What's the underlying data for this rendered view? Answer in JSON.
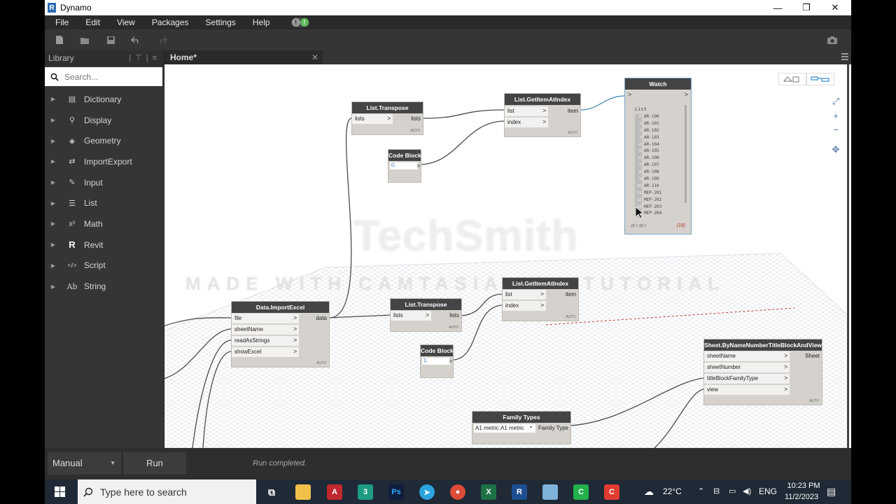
{
  "window": {
    "title": "Dynamo",
    "minimize": "—",
    "maximize": "❐",
    "close": "✕"
  },
  "menu": {
    "items": [
      "File",
      "Edit",
      "View",
      "Packages",
      "Settings",
      "Help"
    ],
    "notify_left": "!",
    "notify_right": "!"
  },
  "library": {
    "title": "Library",
    "search_placeholder": "Search...",
    "items": [
      {
        "label": "Dictionary",
        "icon": "dictionary-icon"
      },
      {
        "label": "Display",
        "icon": "display-icon"
      },
      {
        "label": "Geometry",
        "icon": "geometry-icon"
      },
      {
        "label": "ImportExport",
        "icon": "import-export-icon"
      },
      {
        "label": "Input",
        "icon": "input-icon"
      },
      {
        "label": "List",
        "icon": "list-icon"
      },
      {
        "label": "Math",
        "icon": "math-icon"
      },
      {
        "label": "Revit",
        "icon": "revit-icon"
      },
      {
        "label": "Script",
        "icon": "script-icon"
      },
      {
        "label": "String",
        "icon": "string-icon"
      }
    ],
    "icon_glyphs": [
      "▤",
      "⚲",
      "◈",
      "⇄",
      "✎",
      "☰",
      "x²",
      "R",
      "</>",
      "Ab"
    ]
  },
  "tab": {
    "label": "Home*",
    "close": "✕"
  },
  "nodes": {
    "transpose1": {
      "title": "List.Transpose",
      "in": "lists",
      "out": "lists",
      "auto": "AUTO"
    },
    "code1": {
      "title": "Code Block",
      "code": "0;"
    },
    "getitem1": {
      "title": "List.GetItemAtIndex",
      "in1": "list",
      "in2": "index",
      "out": "item",
      "auto": "AUTO"
    },
    "watch": {
      "title": "Watch",
      "list_label": "List",
      "rows": [
        {
          "i": "0",
          "v": "AR-100"
        },
        {
          "i": "1",
          "v": "AR-101"
        },
        {
          "i": "2",
          "v": "AR-102"
        },
        {
          "i": "3",
          "v": "AR-103"
        },
        {
          "i": "4",
          "v": "AR-104"
        },
        {
          "i": "5",
          "v": "AR-105"
        },
        {
          "i": "6",
          "v": "AR-106"
        },
        {
          "i": "7",
          "v": "AR-107"
        },
        {
          "i": "8",
          "v": "AR-108"
        },
        {
          "i": "9",
          "v": "AR-109"
        },
        {
          "i": "10",
          "v": "AR-110"
        },
        {
          "i": "11",
          "v": "MEP-201"
        },
        {
          "i": "12",
          "v": "MEP-202"
        },
        {
          "i": "13",
          "v": "MEP-203"
        },
        {
          "i": "14",
          "v": "MEP-204"
        }
      ],
      "footer_left": "@L2 @L1",
      "footer_right": "{18}"
    },
    "importexcel": {
      "title": "Data.ImportExcel",
      "in1": "file",
      "in2": "sheetName",
      "in3": "readAsStrings",
      "in4": "showExcel",
      "out": "data",
      "auto": "AUTO"
    },
    "transpose2": {
      "title": "List.Transpose",
      "in": "lists",
      "out": "lists",
      "auto": "AUTO"
    },
    "getitem2": {
      "title": "List.GetItemAtIndex",
      "in1": "list",
      "in2": "index",
      "out": "item",
      "auto": "AUTO"
    },
    "code2": {
      "title": "Code Block",
      "code": "1;"
    },
    "sheet": {
      "title": "Sheet.ByNameNumberTitleBlockAndView",
      "in1": "sheetName",
      "in2": "sheetNumber",
      "in3": "titleBlockFamilyType",
      "in4": "view",
      "out": "Sheet",
      "auto": "AUTO"
    },
    "familytypes": {
      "title": "Family Types",
      "value": "A1 metric:A1 metric",
      "out": "Family Type"
    }
  },
  "watermark": {
    "line1": "TechSmith",
    "line2": "MADE WITH CAMTASIA FOR TUTORIAL"
  },
  "run": {
    "mode": "Manual",
    "button": "Run",
    "status": "Run completed."
  },
  "taskbar": {
    "search_placeholder": "Type here to search",
    "weather": "22°C",
    "lang": "ENG",
    "time": "10:23 PM",
    "date": "11/2/2023"
  }
}
